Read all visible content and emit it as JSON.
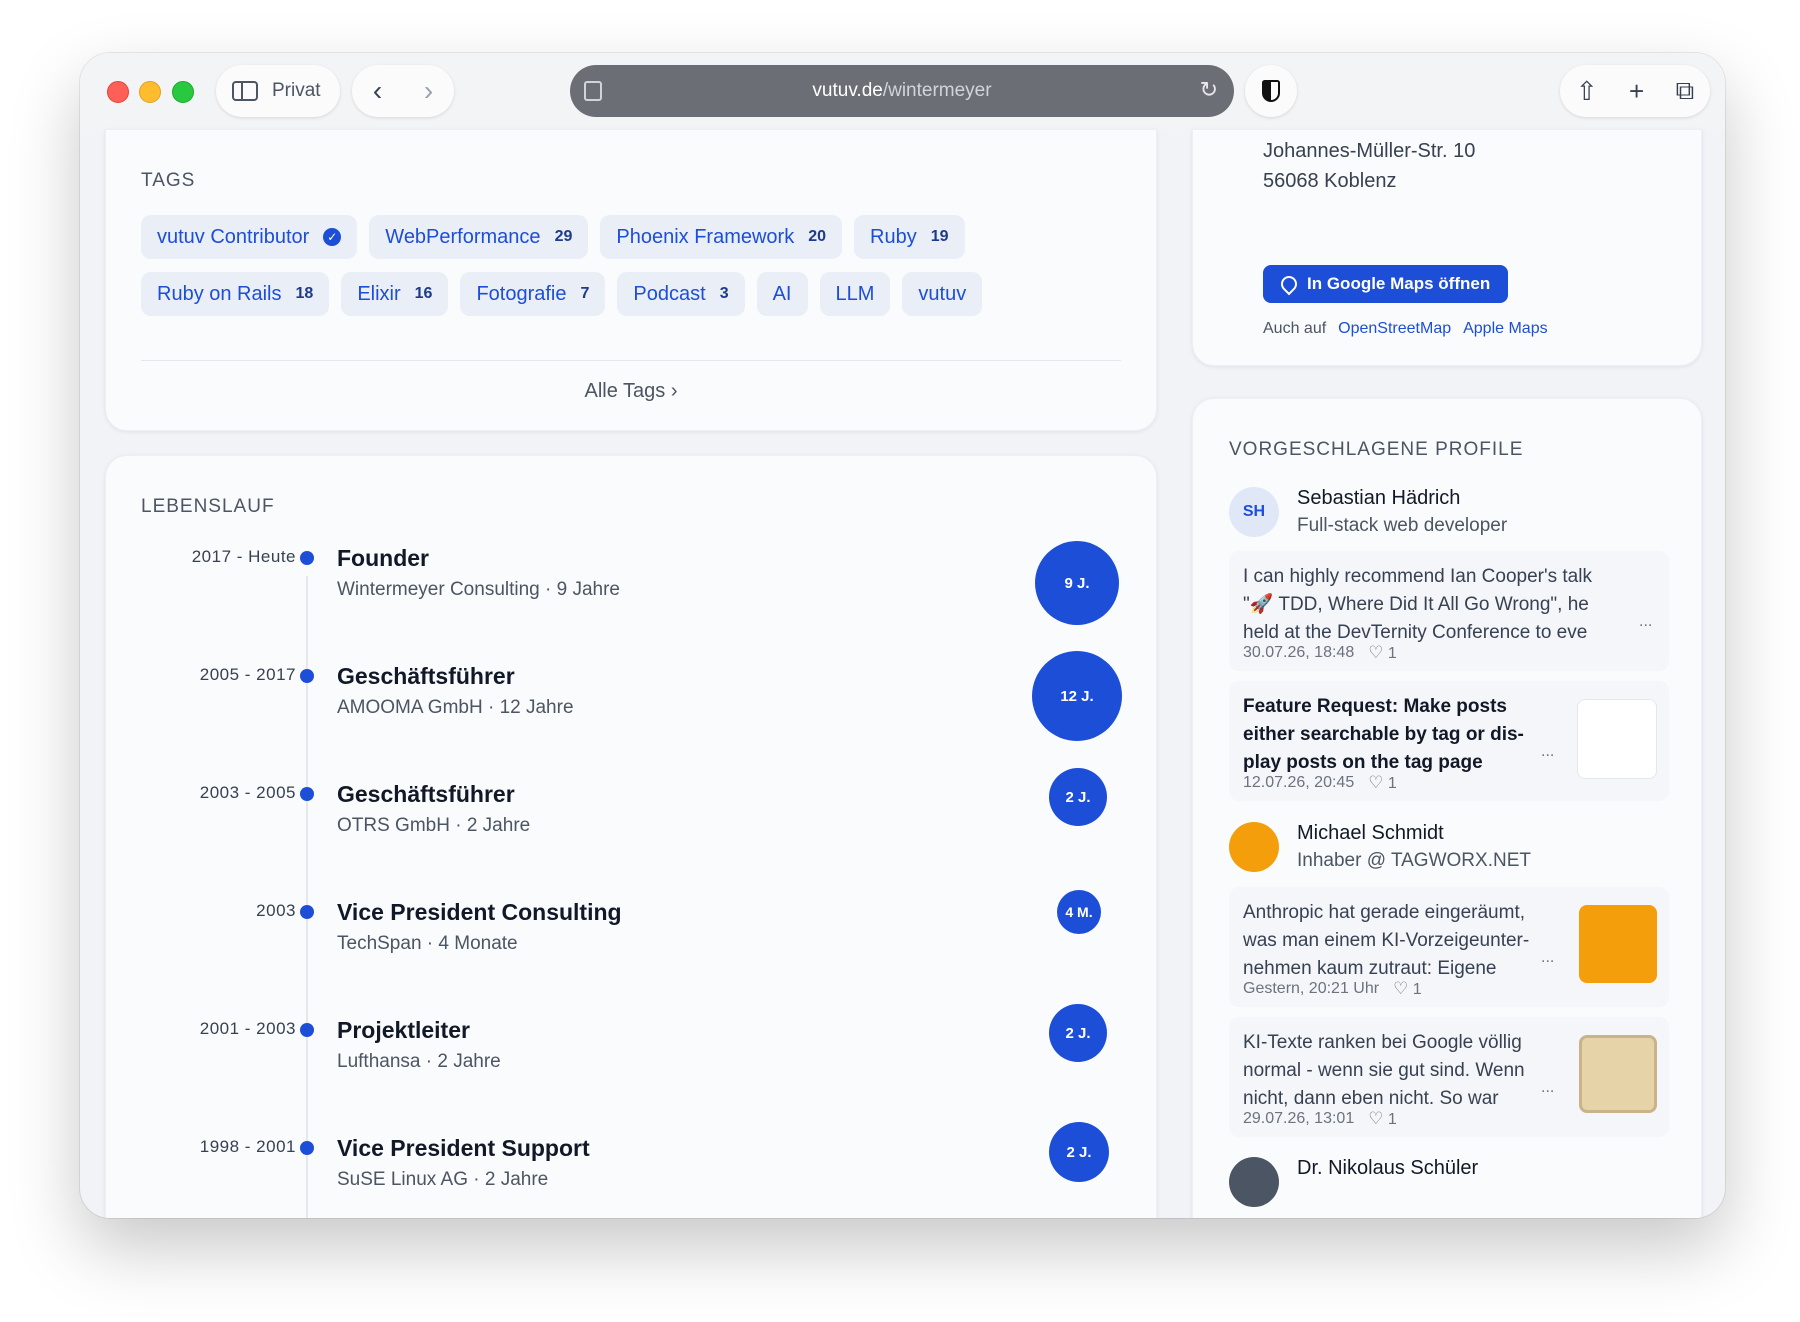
{
  "browser": {
    "mode_label": "Privat",
    "url_domain": "vutuv.de",
    "url_path": "/wintermeyer"
  },
  "tags": {
    "title": "TAGS",
    "row1": [
      {
        "label": "vutuv Contributor",
        "count": "",
        "verified": true
      },
      {
        "label": "WebPerformance",
        "count": "29"
      },
      {
        "label": "Phoenix Framework",
        "count": "20"
      },
      {
        "label": "Ruby",
        "count": "19"
      }
    ],
    "row2": [
      {
        "label": "Ruby on Rails",
        "count": "18"
      },
      {
        "label": "Elixir",
        "count": "16"
      },
      {
        "label": "Fotografie",
        "count": "7"
      },
      {
        "label": "Podcast",
        "count": "3"
      },
      {
        "label": "AI",
        "count": ""
      },
      {
        "label": "LLM",
        "count": ""
      },
      {
        "label": "vutuv",
        "count": ""
      }
    ],
    "all_tags": "Alle Tags"
  },
  "cv": {
    "title": "LEBENSLAUF",
    "items": [
      {
        "date": "2017 - Heute",
        "title": "Founder",
        "sub": "Wintermeyer Consulting · 9 Jahre",
        "badge": "9 J."
      },
      {
        "date": "2005 - 2017",
        "title": "Geschäftsführer",
        "sub": "AMOOMA GmbH · 12 Jahre",
        "badge": "12 J."
      },
      {
        "date": "2003 - 2005",
        "title": "Geschäftsführer",
        "sub": "OTRS GmbH · 2 Jahre",
        "badge": "2 J."
      },
      {
        "date": "2003",
        "title": "Vice President Consulting",
        "sub": "TechSpan · 4 Monate",
        "badge": "4 M."
      },
      {
        "date": "2001 - 2003",
        "title": "Projektleiter",
        "sub": "Lufthansa · 2 Jahre",
        "badge": "2 J."
      },
      {
        "date": "1998 - 2001",
        "title": "Vice President Support",
        "sub": "SuSE Linux AG · 2 Jahre",
        "badge": "2 J."
      }
    ]
  },
  "address": {
    "street": "Johannes-Müller-Str. 10",
    "city": "56068 Koblenz",
    "maps_button": "In Google Maps öffnen",
    "also_label": "Auch auf",
    "osm": "OpenStreetMap",
    "apple": "Apple Maps"
  },
  "suggested": {
    "title": "VORGESCHLAGENE PROFILE",
    "p1": {
      "initials": "SH",
      "name": "Sebastian Hädrich",
      "role": "Full-stack web developer",
      "post1": {
        "line1": "I can highly recommend Ian Cooper's talk",
        "line2": "\"🚀 TDD, Where Did It All Go Wrong\", he",
        "line3": "held at the DevTernity Conference to eve",
        "meta": "30.07.26, 18:48",
        "likes": "1"
      },
      "post2": {
        "line1": "Feature Request: Make posts",
        "line2": "either searchable by tag or dis-",
        "line3": "play posts on the tag page",
        "meta": "12.07.26, 20:45",
        "likes": "1"
      }
    },
    "p2": {
      "name": "Michael Schmidt",
      "role": "Inhaber @ TAGWORX.NET",
      "post1": {
        "line1": "Anthropic hat gerade eingeräumt,",
        "line2": "was man einem KI-Vorzeigeunter-",
        "line3": "nehmen kaum zutraut: Eigene",
        "meta": "Gestern, 20:21 Uhr",
        "likes": "1"
      },
      "post2": {
        "line1": "KI-Texte ranken bei Google völlig",
        "line2": "normal - wenn sie gut sind. Wenn",
        "line3": "nicht, dann eben nicht. So war",
        "meta": "29.07.26, 13:01",
        "likes": "1"
      }
    },
    "p3": {
      "name": "Dr. Nikolaus Schüler"
    }
  }
}
